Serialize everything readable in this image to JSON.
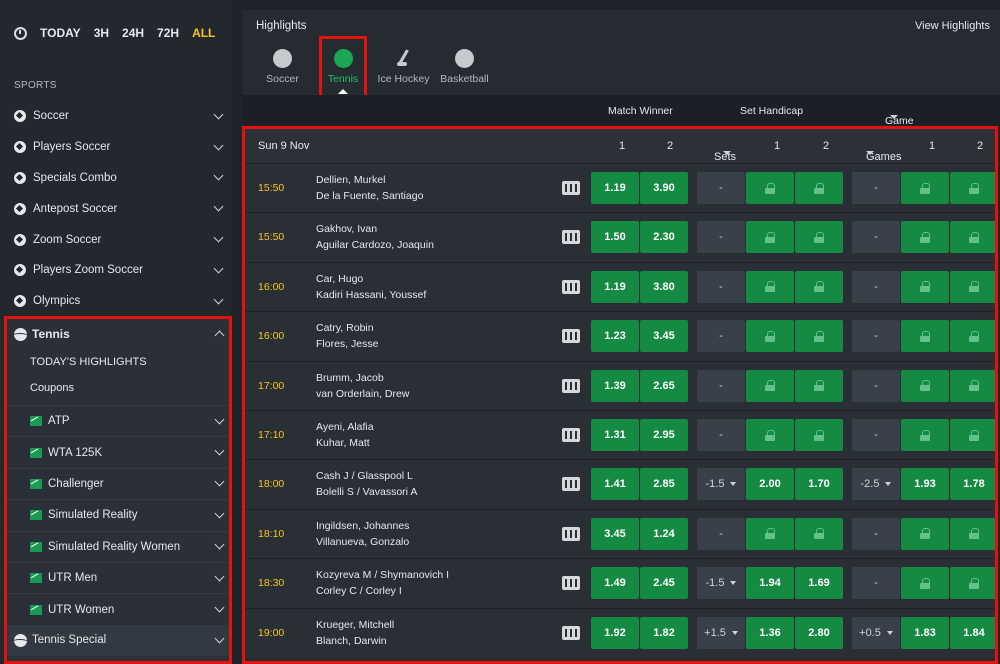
{
  "timebar": {
    "items": [
      "TODAY",
      "3H",
      "24H",
      "72H",
      "ALL"
    ],
    "active": "ALL"
  },
  "sidebar": {
    "sports_title": "SPORTS",
    "items": [
      {
        "label": "Soccer",
        "icon": "soccer-ball-icon"
      },
      {
        "label": "Players Soccer",
        "icon": "player-icon"
      },
      {
        "label": "Specials Combo",
        "icon": "soccer-ball-icon"
      },
      {
        "label": "Antepost Soccer",
        "icon": "soccer-ball-icon"
      },
      {
        "label": "Zoom Soccer",
        "icon": "zoom-soccer-icon"
      },
      {
        "label": "Players Zoom Soccer",
        "icon": "zoom-soccer-icon"
      },
      {
        "label": "Olympics",
        "icon": "olympic-rings-icon"
      }
    ],
    "tennis": {
      "label": "Tennis",
      "links": [
        "TODAY'S HIGHLIGHTS",
        "Coupons"
      ],
      "sub": [
        "ATP",
        "WTA 125K",
        "Challenger",
        "Simulated Reality",
        "Simulated Reality Women",
        "UTR Men",
        "UTR Women"
      ]
    },
    "tennis_special": "Tennis Special"
  },
  "highlights": {
    "title": "Highlights",
    "view_label": "View Highlights",
    "tabs": [
      {
        "label": "Soccer",
        "icon": "soccer-ball-icon",
        "active": false
      },
      {
        "label": "Tennis",
        "icon": "tennis-ball-icon",
        "active": true
      },
      {
        "label": "Ice Hockey",
        "icon": "hockey-stick-icon",
        "active": false
      },
      {
        "label": "Basketball",
        "icon": "basketball-icon",
        "active": false
      }
    ]
  },
  "markets": {
    "match_winner": "Match Winner",
    "set_handicap": "Set Handicap",
    "game_handicap": "Game Handicap"
  },
  "date_row": {
    "date": "Sun 9 Nov",
    "c1": "1",
    "c2": "2",
    "sets": "Sets",
    "s1": "1",
    "s2": "2",
    "games": "Games",
    "g1": "1",
    "g2": "2"
  },
  "events": [
    {
      "time": "15:50",
      "p1": "Dellien, Murkel",
      "p2": "De la Fuente, Santiago",
      "mw": [
        "1.19",
        "3.90"
      ],
      "sh": [
        "-",
        null,
        null
      ],
      "gh": [
        "-",
        null,
        null
      ]
    },
    {
      "time": "15:50",
      "p1": "Gakhov, Ivan",
      "p2": "Aguilar Cardozo, Joaquin",
      "mw": [
        "1.50",
        "2.30"
      ],
      "sh": [
        "-",
        null,
        null
      ],
      "gh": [
        "-",
        null,
        null
      ]
    },
    {
      "time": "16:00",
      "p1": "Car, Hugo",
      "p2": "Kadiri Hassani, Youssef",
      "mw": [
        "1.19",
        "3.80"
      ],
      "sh": [
        "-",
        null,
        null
      ],
      "gh": [
        "-",
        null,
        null
      ]
    },
    {
      "time": "16:00",
      "p1": "Catry, Robin",
      "p2": "Flores, Jesse",
      "mw": [
        "1.23",
        "3.45"
      ],
      "sh": [
        "-",
        null,
        null
      ],
      "gh": [
        "-",
        null,
        null
      ]
    },
    {
      "time": "17:00",
      "p1": "Brumm, Jacob",
      "p2": "van Orderlain, Drew",
      "mw": [
        "1.39",
        "2.65"
      ],
      "sh": [
        "-",
        null,
        null
      ],
      "gh": [
        "-",
        null,
        null
      ]
    },
    {
      "time": "17:10",
      "p1": "Ayeni, Alafia",
      "p2": "Kuhar, Matt",
      "mw": [
        "1.31",
        "2.95"
      ],
      "sh": [
        "-",
        null,
        null
      ],
      "gh": [
        "-",
        null,
        null
      ]
    },
    {
      "time": "18:00",
      "p1": "Cash J / Glasspool L",
      "p2": "Bolelli S / Vavassori A",
      "mw": [
        "1.41",
        "2.85"
      ],
      "sh": [
        "-1.5",
        "2.00",
        "1.70"
      ],
      "gh": [
        "-2.5",
        "1.93",
        "1.78"
      ]
    },
    {
      "time": "18:10",
      "p1": "Ingildsen, Johannes",
      "p2": "Villanueva, Gonzalo",
      "mw": [
        "3.45",
        "1.24"
      ],
      "sh": [
        "-",
        null,
        null
      ],
      "gh": [
        "-",
        null,
        null
      ]
    },
    {
      "time": "18:30",
      "p1": "Kozyreva M / Shymanovich I",
      "p2": "Corley C / Corley I",
      "mw": [
        "1.49",
        "2.45"
      ],
      "sh": [
        "-1.5",
        "1.94",
        "1.69"
      ],
      "gh": [
        "-",
        null,
        null
      ]
    },
    {
      "time": "19:00",
      "p1": "Krueger, Mitchell",
      "p2": "Blanch, Darwin",
      "mw": [
        "1.92",
        "1.82"
      ],
      "sh": [
        "+1.5",
        "1.36",
        "2.80"
      ],
      "gh": [
        "+0.5",
        "1.83",
        "1.84"
      ]
    }
  ]
}
